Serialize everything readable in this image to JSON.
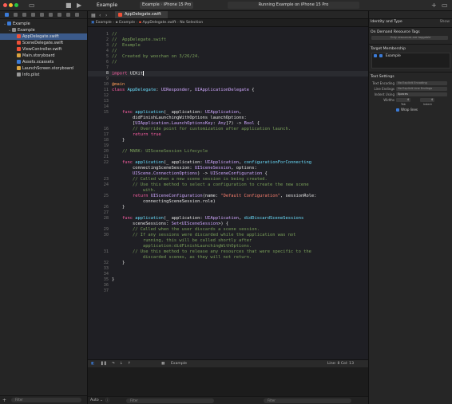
{
  "toolbar": {
    "project_title": "Example",
    "scheme": "Example",
    "device": "iPhone 15 Pro",
    "run_status": "Running Example on iPhone 15 Pro",
    "play_icon": "play-icon",
    "stop_icon": "stop-icon"
  },
  "navigator": {
    "items": [
      {
        "label": "Example",
        "indent": 0,
        "icon": "project-icon",
        "color": "#3b7bd8"
      },
      {
        "label": "Example",
        "indent": 1,
        "icon": "folder-icon",
        "color": "#8a8a8a"
      },
      {
        "label": "AppDelegate.swift",
        "indent": 2,
        "icon": "swift-file-icon",
        "color": "#f05138",
        "selected": true
      },
      {
        "label": "SceneDelegate.swift",
        "indent": 2,
        "icon": "swift-file-icon",
        "color": "#f05138"
      },
      {
        "label": "ViewController.swift",
        "indent": 2,
        "icon": "swift-file-icon",
        "color": "#f05138"
      },
      {
        "label": "Main.storyboard",
        "indent": 2,
        "icon": "storyboard-icon",
        "color": "#d9a441"
      },
      {
        "label": "Assets.xcassets",
        "indent": 2,
        "icon": "assets-icon",
        "color": "#3b7bd8"
      },
      {
        "label": "LaunchScreen.storyboard",
        "indent": 2,
        "icon": "storyboard-icon",
        "color": "#d9a441"
      },
      {
        "label": "Info.plist",
        "indent": 2,
        "icon": "plist-icon",
        "color": "#9a9a9a"
      }
    ],
    "filter_placeholder": "Filter"
  },
  "editor": {
    "tab_label": "AppDelegate.swift",
    "jump_bar": [
      "Example",
      "Example",
      "AppDelegate.swift",
      "No Selection"
    ],
    "current_line": 8,
    "lines": [
      {
        "n": 1,
        "t": [
          [
            "cmt",
            "//"
          ]
        ]
      },
      {
        "n": 2,
        "t": [
          [
            "cmt",
            "//  AppDelegate.swift"
          ]
        ]
      },
      {
        "n": 3,
        "t": [
          [
            "cmt",
            "//  Example"
          ]
        ]
      },
      {
        "n": 4,
        "t": [
          [
            "cmt",
            "//"
          ]
        ]
      },
      {
        "n": 5,
        "t": [
          [
            "cmt",
            "//  Created by woochan on 3/26/24."
          ]
        ]
      },
      {
        "n": 6,
        "t": [
          [
            "cmt",
            "//"
          ]
        ]
      },
      {
        "n": 7,
        "t": []
      },
      {
        "n": 8,
        "t": [
          [
            "kw",
            "import "
          ],
          [
            "pl",
            "UIKit"
          ]
        ]
      },
      {
        "n": 9,
        "t": []
      },
      {
        "n": 10,
        "t": [
          [
            "at",
            "@main"
          ]
        ]
      },
      {
        "n": 11,
        "t": [
          [
            "kw",
            "class "
          ],
          [
            "fn",
            "AppDelegate"
          ],
          [
            "pl",
            ": "
          ],
          [
            "ty",
            "UIResponder"
          ],
          [
            "pl",
            ", "
          ],
          [
            "ty",
            "UIApplicationDelegate"
          ],
          [
            "pl",
            " {"
          ]
        ]
      },
      {
        "n": 12,
        "t": []
      },
      {
        "n": 13,
        "t": []
      },
      {
        "n": 14,
        "t": []
      },
      {
        "n": 15,
        "t": [
          [
            "pl",
            "    "
          ],
          [
            "kw",
            "func "
          ],
          [
            "fn",
            "application"
          ],
          [
            "pl",
            "(_ application: "
          ],
          [
            "ty",
            "UIApplication"
          ],
          [
            "pl",
            ","
          ]
        ]
      },
      {
        "n": null,
        "t": [
          [
            "pl",
            "        didFinishLaunchingWithOptions launchOptions:"
          ]
        ]
      },
      {
        "n": null,
        "t": [
          [
            "pl",
            "        ["
          ],
          [
            "ty",
            "UIApplication"
          ],
          [
            "pl",
            "."
          ],
          [
            "ty",
            "LaunchOptionsKey"
          ],
          [
            "pl",
            ": "
          ],
          [
            "ty",
            "Any"
          ],
          [
            "pl",
            "]?) -> "
          ],
          [
            "ty",
            "Bool"
          ],
          [
            "pl",
            " {"
          ]
        ]
      },
      {
        "n": 16,
        "t": [
          [
            "cmt",
            "        // Override point for customization after application launch."
          ]
        ]
      },
      {
        "n": 17,
        "t": [
          [
            "pl",
            "        "
          ],
          [
            "kw",
            "return "
          ],
          [
            "kw",
            "true"
          ]
        ]
      },
      {
        "n": 18,
        "t": [
          [
            "pl",
            "    }"
          ]
        ]
      },
      {
        "n": 19,
        "t": []
      },
      {
        "n": 20,
        "t": [
          [
            "cmt",
            "    // MARK: UISceneSession Lifecycle"
          ]
        ]
      },
      {
        "n": 21,
        "t": []
      },
      {
        "n": 22,
        "t": [
          [
            "pl",
            "    "
          ],
          [
            "kw",
            "func "
          ],
          [
            "fn",
            "application"
          ],
          [
            "pl",
            "(_ application: "
          ],
          [
            "ty",
            "UIApplication"
          ],
          [
            "pl",
            ", "
          ],
          [
            "fn",
            "configurationForConnecting"
          ]
        ]
      },
      {
        "n": null,
        "t": [
          [
            "pl",
            "        connectingSceneSession: "
          ],
          [
            "ty",
            "UISceneSession"
          ],
          [
            "pl",
            ", options:"
          ]
        ]
      },
      {
        "n": null,
        "t": [
          [
            "pl",
            "        "
          ],
          [
            "ty",
            "UIScene"
          ],
          [
            "pl",
            "."
          ],
          [
            "ty",
            "ConnectionOptions"
          ],
          [
            "pl",
            ") -> "
          ],
          [
            "ty",
            "UISceneConfiguration"
          ],
          [
            "pl",
            " {"
          ]
        ]
      },
      {
        "n": 23,
        "t": [
          [
            "cmt",
            "        // Called when a new scene session is being created."
          ]
        ]
      },
      {
        "n": 24,
        "t": [
          [
            "cmt",
            "        // Use this method to select a configuration to create the new scene"
          ]
        ]
      },
      {
        "n": null,
        "t": [
          [
            "cmt",
            "            with."
          ]
        ]
      },
      {
        "n": 25,
        "t": [
          [
            "pl",
            "        "
          ],
          [
            "kw",
            "return "
          ],
          [
            "ty",
            "UISceneConfiguration"
          ],
          [
            "pl",
            "(name: "
          ],
          [
            "st",
            "\"Default Configuration\""
          ],
          [
            "pl",
            ", sessionRole:"
          ]
        ]
      },
      {
        "n": null,
        "t": [
          [
            "pl",
            "            connectingSceneSession.role)"
          ]
        ]
      },
      {
        "n": 26,
        "t": [
          [
            "pl",
            "    }"
          ]
        ]
      },
      {
        "n": 27,
        "t": []
      },
      {
        "n": 28,
        "t": [
          [
            "pl",
            "    "
          ],
          [
            "kw",
            "func "
          ],
          [
            "fn",
            "application"
          ],
          [
            "pl",
            "(_ application: "
          ],
          [
            "ty",
            "UIApplication"
          ],
          [
            "pl",
            ", "
          ],
          [
            "fn",
            "didDiscardSceneSessions"
          ]
        ]
      },
      {
        "n": null,
        "t": [
          [
            "pl",
            "        sceneSessions: "
          ],
          [
            "ty",
            "Set"
          ],
          [
            "pl",
            "<"
          ],
          [
            "ty",
            "UISceneSession"
          ],
          [
            "pl",
            ">) {"
          ]
        ]
      },
      {
        "n": 29,
        "t": [
          [
            "cmt",
            "        // Called when the user discards a scene session."
          ]
        ]
      },
      {
        "n": 30,
        "t": [
          [
            "cmt",
            "        // If any sessions were discarded while the application was not"
          ]
        ]
      },
      {
        "n": null,
        "t": [
          [
            "cmt",
            "            running, this will be called shortly after"
          ]
        ]
      },
      {
        "n": null,
        "t": [
          [
            "cmt",
            "            application:didFinishLaunchingWithOptions."
          ]
        ]
      },
      {
        "n": 31,
        "t": [
          [
            "cmt",
            "        // Use this method to release any resources that were specific to the"
          ]
        ]
      },
      {
        "n": null,
        "t": [
          [
            "cmt",
            "            discarded scenes, as they will not return."
          ]
        ]
      },
      {
        "n": 32,
        "t": [
          [
            "pl",
            "    }"
          ]
        ]
      },
      {
        "n": 33,
        "t": []
      },
      {
        "n": 34,
        "t": []
      },
      {
        "n": 35,
        "t": [
          [
            "pl",
            "}"
          ]
        ]
      },
      {
        "n": 36,
        "t": []
      },
      {
        "n": 37,
        "t": []
      }
    ]
  },
  "debugbar": {
    "target": "Example",
    "position": "Line: 8  Col: 13"
  },
  "console": {
    "mode": "Auto",
    "filter_placeholder": "Filter",
    "filter_placeholder_2": "Filter"
  },
  "inspector": {
    "identity_header": "Identity and Type",
    "show_label": "Show",
    "odr_header": "On Demand Resource Tags",
    "odr_placeholder": "Only resources are taggable",
    "target_header": "Target Membership",
    "target_item": "Example",
    "text_header": "Text Settings",
    "text_encoding_label": "Text Encoding",
    "text_encoding_value": "No Explicit Encoding",
    "line_endings_label": "Line Endings",
    "line_endings_value": "No Explicit Line Endings",
    "indent_using_label": "Indent Using",
    "indent_using_value": "Spaces",
    "widths_label": "Widths",
    "tab_width": "4",
    "indent_width": "4",
    "tab_caption": "Tab",
    "indent_caption": "Indent",
    "wrap_lines_label": "Wrap lines"
  }
}
